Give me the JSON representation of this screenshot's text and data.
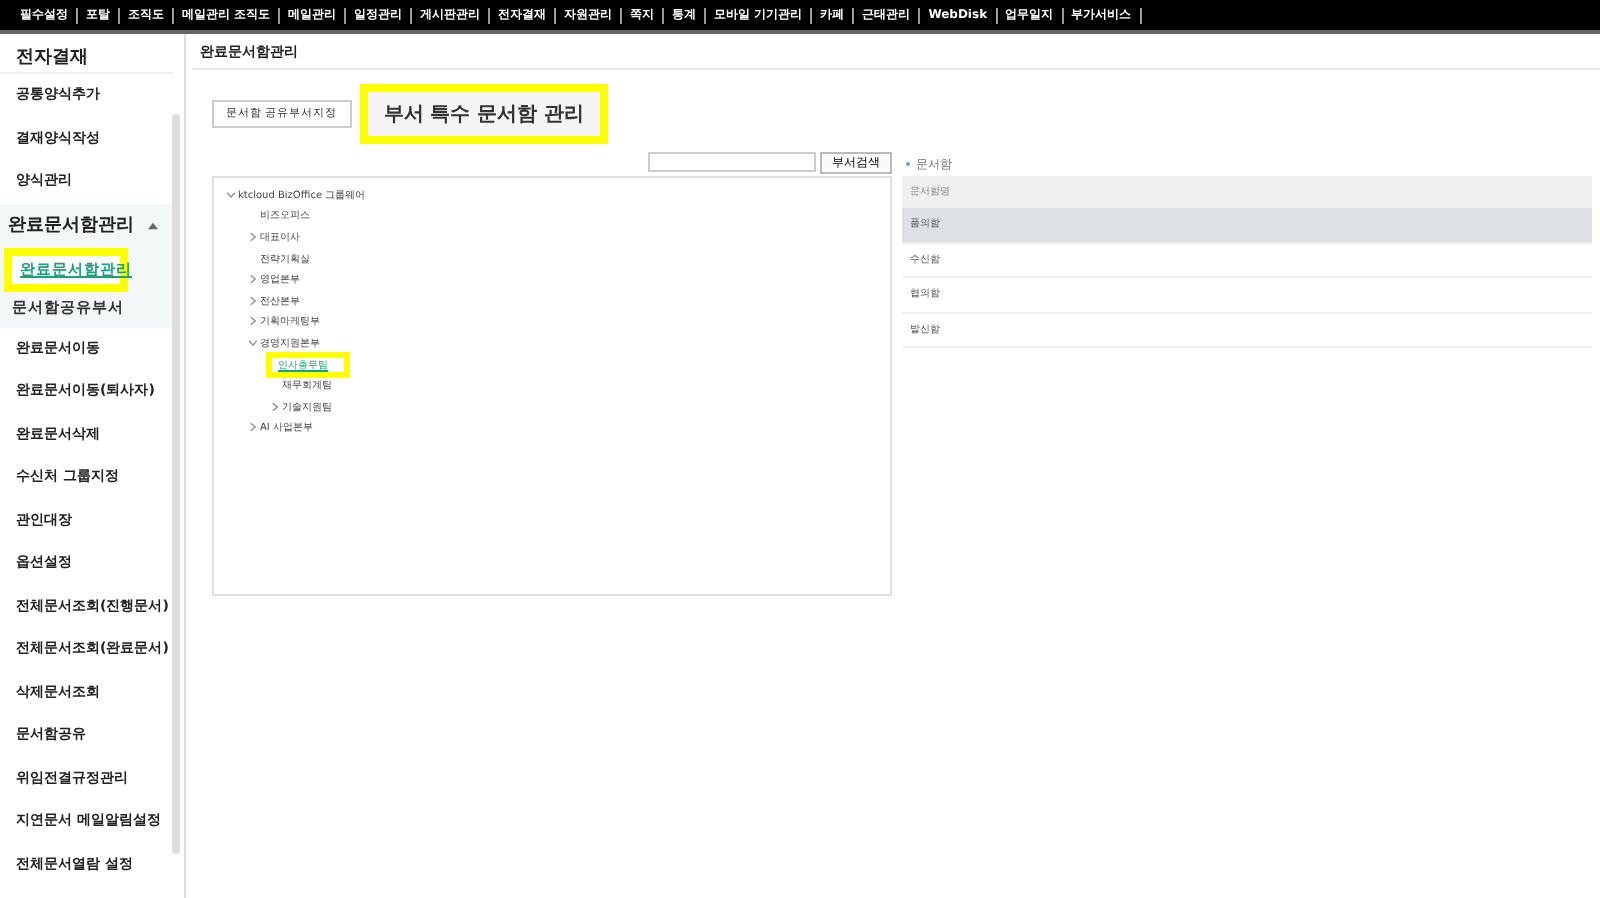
{
  "top_menu": [
    "필수설정",
    "포탈",
    "조직도",
    "메일관리 조직도",
    "메일관리",
    "일정관리",
    "게시판관리",
    "전자결재",
    "자원관리",
    "쪽지",
    "통계",
    "모바일 기기관리",
    "카페",
    "근태관리",
    "WebDisk",
    "업무일지",
    "부가서비스"
  ],
  "sidebar": {
    "title": "전자결재",
    "items": [
      {
        "label": "공통양식추가",
        "selected": false
      },
      {
        "label": "결재양식작성",
        "selected": false
      },
      {
        "label": "양식관리",
        "selected": false
      },
      {
        "label": "완료문서함관리",
        "selected": false,
        "expanded": true,
        "children": [
          {
            "label": "완료문서함관리",
            "selected": true,
            "highlighted": true
          },
          {
            "label": "문서함공유부서",
            "selected": false,
            "highlighted": false
          }
        ]
      },
      {
        "label": "완료문서이동",
        "selected": false
      },
      {
        "label": "완료문서이동(퇴사자)",
        "selected": false
      },
      {
        "label": "완료문서삭제",
        "selected": false
      },
      {
        "label": "수신처 그룹지정",
        "selected": false
      },
      {
        "label": "관인대장",
        "selected": false
      },
      {
        "label": "옵션설정",
        "selected": false
      },
      {
        "label": "전체문서조회(진행문서)",
        "selected": false
      },
      {
        "label": "전체문서조회(완료문서)",
        "selected": false
      },
      {
        "label": "삭제문서조회",
        "selected": false
      },
      {
        "label": "문서함공유",
        "selected": false
      },
      {
        "label": "위임전결규정관리",
        "selected": false
      },
      {
        "label": "지연문서 메일알림설정",
        "selected": false
      },
      {
        "label": "전체문서열람 설정",
        "selected": false
      }
    ]
  },
  "page_title": "완료문서함관리",
  "tabs": [
    {
      "label": "문서함 공유부서지정",
      "selected": false,
      "highlighted": false
    },
    {
      "label": "부서 특수 문서함 관리",
      "selected": true,
      "highlighted": true
    }
  ],
  "search": {
    "button": "부서검색"
  },
  "tree": [
    {
      "label": "ktcloud BizOffice 그룹웨어",
      "expanded": true,
      "selected": false,
      "highlighted": false,
      "children": [
        {
          "label": "비즈오피스",
          "selected": false,
          "highlighted": false
        },
        {
          "label": "대표이사",
          "expanded": false,
          "selected": false,
          "highlighted": false
        },
        {
          "label": "전략기획실",
          "selected": false,
          "highlighted": false
        },
        {
          "label": "영업본부",
          "expanded": false,
          "selected": false,
          "highlighted": false
        },
        {
          "label": "전산본부",
          "expanded": false,
          "selected": false,
          "highlighted": false
        },
        {
          "label": "기획마케팅부",
          "expanded": false,
          "selected": false,
          "highlighted": false
        },
        {
          "label": "경영지원본부",
          "expanded": true,
          "selected": false,
          "highlighted": false,
          "children": [
            {
              "label": "인사총무팀",
              "selected": true,
              "highlighted": true
            },
            {
              "label": "재무회계팀",
              "selected": false,
              "highlighted": false
            },
            {
              "label": "기술지원팀",
              "expanded": false,
              "selected": false,
              "highlighted": false
            }
          ]
        },
        {
          "label": "AI 사업본부",
          "expanded": false,
          "selected": false,
          "highlighted": false
        }
      ]
    }
  ],
  "mailbox_panel": {
    "label": "문서함",
    "column": "문서함명",
    "rows": [
      {
        "name": "품의함",
        "selected": true
      },
      {
        "name": "수신함",
        "selected": false
      },
      {
        "name": "협의함",
        "selected": false
      },
      {
        "name": "발신함",
        "selected": false
      }
    ]
  }
}
